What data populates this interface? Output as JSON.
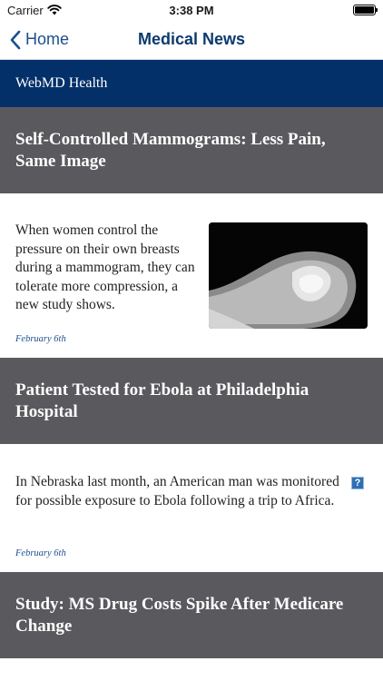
{
  "status": {
    "carrier": "Carrier",
    "time": "3:38 PM"
  },
  "nav": {
    "back_label": "Home",
    "title": "Medical News"
  },
  "source": {
    "name": "WebMD Health"
  },
  "articles": [
    {
      "headline": "Self-Controlled Mammograms: Less Pain, Same Image",
      "summary": "When women control the pressure on their own breasts during a mammogram, they can tolerate more compression, a new study shows.",
      "date": "February 6th"
    },
    {
      "headline": "Patient Tested for Ebola at Philadelphia Hospital",
      "summary": "In Nebraska last month, an American man was monitored for possible exposure to Ebola following a trip to Africa.",
      "date": "February 6th",
      "icon": "?"
    },
    {
      "headline": "Study: MS Drug Costs Spike After Medicare Change"
    }
  ],
  "colors": {
    "accent": "#1c4f8f",
    "source_bar": "#04306a",
    "headline_bg": "#5a5a5e"
  }
}
